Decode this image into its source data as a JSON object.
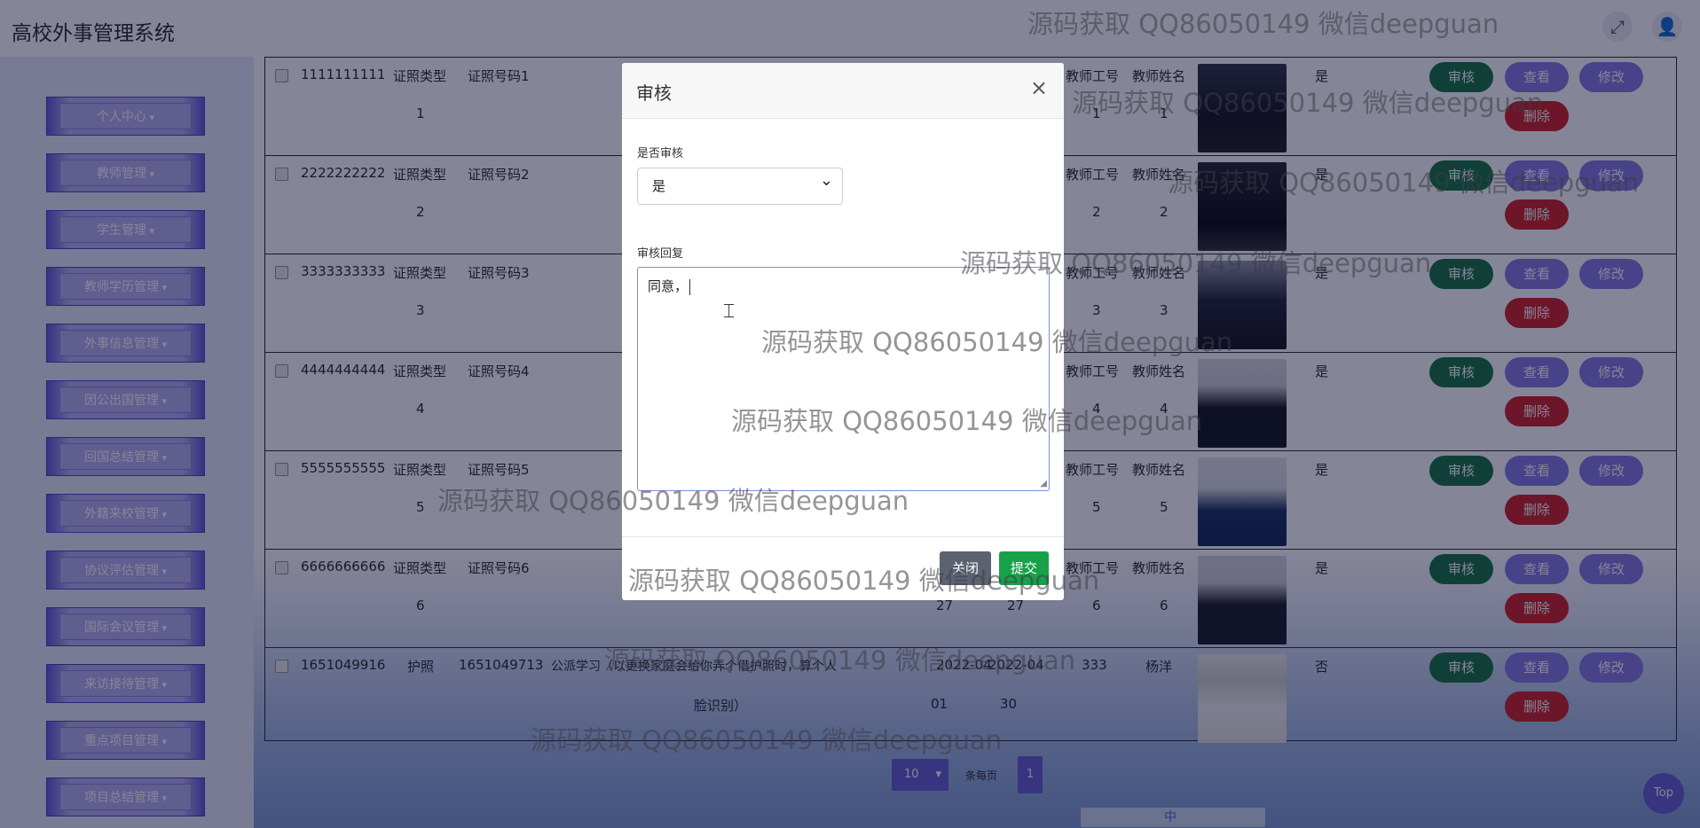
{
  "header": {
    "title": "高校外事管理系统"
  },
  "sidebar": {
    "items": [
      "个人中心",
      "教师管理",
      "学生管理",
      "教师学历管理",
      "外事信息管理",
      "因公出国管理",
      "回国总结管理",
      "外籍来校管理",
      "协议评估管理",
      "国际会议管理",
      "来访接待管理",
      "重点项目管理",
      "项目总结管理"
    ]
  },
  "table": {
    "rows": [
      {
        "num": "1111111111",
        "type": "证照类型",
        "code": "证照号码1",
        "num2": "1",
        "tid": "教师工号",
        "tid2": "1",
        "tname": "教师姓名",
        "tname2": "1",
        "review": "是"
      },
      {
        "num": "2222222222",
        "type": "证照类型",
        "code": "证照号码2",
        "num2": "2",
        "tid": "教师工号",
        "tid2": "2",
        "tname": "教师姓名",
        "tname2": "2",
        "review": "是"
      },
      {
        "num": "3333333333",
        "type": "证照类型",
        "code": "证照号码3",
        "num2": "3",
        "tid": "教师工号",
        "tid2": "3",
        "tname": "教师姓名",
        "tname2": "3",
        "review": "是"
      },
      {
        "num": "4444444444",
        "type": "证照类型",
        "code": "证照号码4",
        "num2": "4",
        "tid": "教师工号",
        "tid2": "4",
        "tname": "教师姓名",
        "tname2": "4",
        "review": "是"
      },
      {
        "num": "5555555555",
        "type": "证照类型",
        "code": "证照号码5",
        "num2": "5",
        "tid": "教师工号",
        "tid2": "5",
        "tname": "教师姓名",
        "tname2": "5",
        "review": "是"
      },
      {
        "num": "6666666666",
        "type": "证照类型",
        "code": "证照号码6",
        "num2": "6",
        "d1": "27",
        "d2": "27",
        "tid": "教师工号",
        "tid2": "6",
        "tname": "教师姓名",
        "tname2": "6",
        "review": "是"
      },
      {
        "num": "1651049916",
        "type": "护照",
        "code": "1651049713",
        "reason": "公派学习（以更换家庭会给你弄个借护照时，算个人",
        "reason2": "脸识别）",
        "d1": "2022-04",
        "d1b": "01",
        "d2": "2022-04",
        "d2b": "30",
        "tid": "333",
        "tname": "杨洋",
        "review": "否"
      }
    ],
    "btn_review": "审核",
    "btn_view": "查看",
    "btn_edit": "修改",
    "btn_delete": "删除"
  },
  "pagination": {
    "page_size": "10",
    "per_page_label": "条每页",
    "current_page": "1"
  },
  "top_button": "Top",
  "taskbar": "中",
  "modal": {
    "title": "审核",
    "close_symbol": "×",
    "review_label": "是否审核",
    "review_value": "是",
    "reply_label": "审核回复",
    "reply_value": "同意，",
    "close_button": "关闭",
    "submit_button": "提交"
  },
  "watermark": "源码获取 QQ86050149 微信deepguan",
  "colors": {
    "primary": "#6c64d2",
    "approve": "#1f7a45",
    "danger": "#d22b2b",
    "submit": "#19a14a"
  }
}
